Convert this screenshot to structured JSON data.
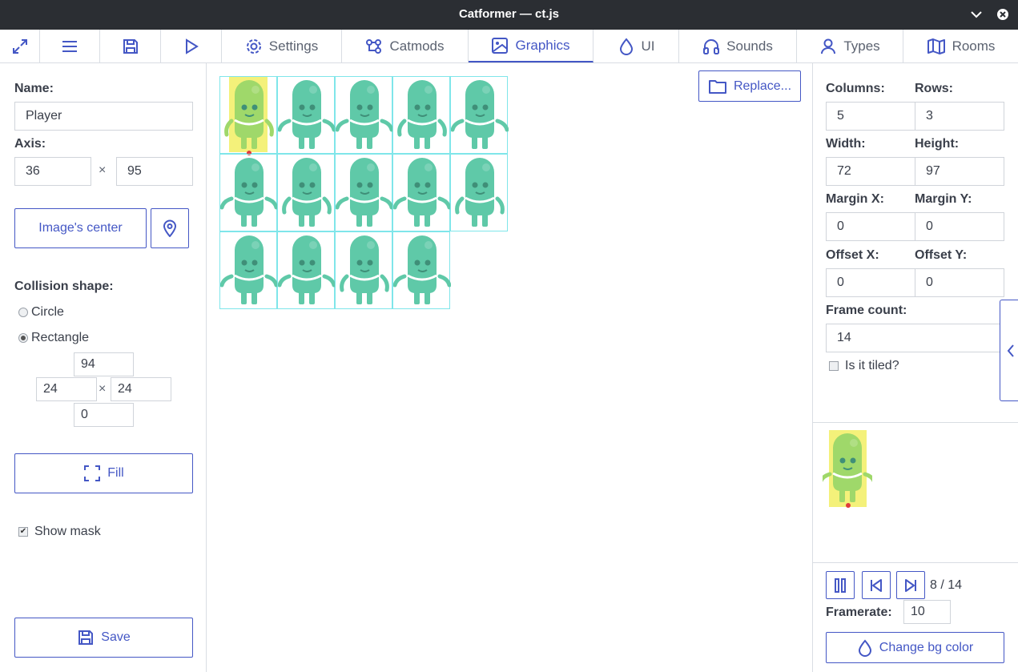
{
  "window": {
    "title": "Catformer — ct.js"
  },
  "tabs": [
    {
      "label": "Settings",
      "icon": "gear-icon"
    },
    {
      "label": "Catmods",
      "icon": "catmods-icon"
    },
    {
      "label": "Graphics",
      "icon": "image-icon",
      "active": true
    },
    {
      "label": "UI",
      "icon": "droplet-icon"
    },
    {
      "label": "Sounds",
      "icon": "headphones-icon"
    },
    {
      "label": "Types",
      "icon": "user-icon"
    },
    {
      "label": "Rooms",
      "icon": "map-icon"
    }
  ],
  "toolbar": {
    "icons": [
      "maximize-icon",
      "menu-icon",
      "save-icon",
      "play-icon"
    ]
  },
  "left": {
    "name_label": "Name:",
    "name_value": "Player",
    "axis_label": "Axis:",
    "axis_x": "36",
    "axis_y": "95",
    "times": "×",
    "image_center_label": "Image's center",
    "collision_label": "Collision shape:",
    "circle_label": "Circle",
    "rectangle_label": "Rectangle",
    "selected_shape": "Rectangle",
    "rect_top": "94",
    "rect_left": "24",
    "rect_right": "24",
    "rect_bottom": "0",
    "fill_label": "Fill",
    "show_mask_label": "Show mask",
    "show_mask_checked": true,
    "save_label": "Save"
  },
  "center": {
    "replace_label": "Replace...",
    "frames": 14,
    "highlighted_frame": 1
  },
  "right": {
    "columns_label": "Columns:",
    "columns_value": "5",
    "rows_label": "Rows:",
    "rows_value": "3",
    "width_label": "Width:",
    "width_value": "72",
    "height_label": "Height:",
    "height_value": "97",
    "margin_x_label": "Margin X:",
    "margin_x_value": "0",
    "margin_y_label": "Margin Y:",
    "margin_y_value": "0",
    "offset_x_label": "Offset X:",
    "offset_x_value": "0",
    "offset_y_label": "Offset Y:",
    "offset_y_value": "0",
    "frame_count_label": "Frame count:",
    "frame_count_value": "14",
    "tiled_label": "Is it tiled?",
    "tiled_checked": false,
    "frame_counter": "8 / 14",
    "framerate_label": "Framerate:",
    "framerate_value": "10",
    "change_bg_label": "Change bg color"
  },
  "colors": {
    "accent": "#4457c5",
    "mask": "#f4f17a",
    "grid": "#7fe6ea",
    "character": "#5fc9a8",
    "axis": "#e03c3c"
  }
}
